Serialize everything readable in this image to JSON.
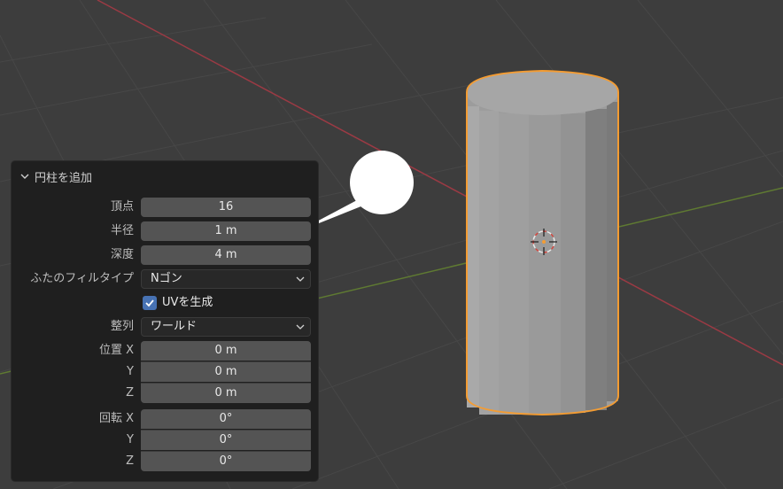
{
  "panel": {
    "title": "円柱を追加",
    "rows": {
      "vertices": {
        "label": "頂点",
        "value": "16"
      },
      "radius": {
        "label": "半径",
        "value": "1 m"
      },
      "depth": {
        "label": "深度",
        "value": "4 m"
      },
      "cap_fill": {
        "label": "ふたのフィルタイプ",
        "value": "Nゴン"
      },
      "generate_uv": {
        "label": "UVを生成",
        "checked": true
      },
      "align": {
        "label": "整列",
        "value": "ワールド"
      },
      "location": {
        "label": "位置 X",
        "x": "0 m",
        "y_label": "Y",
        "y": "0 m",
        "z_label": "Z",
        "z": "0 m"
      },
      "rotation": {
        "label": "回転 X",
        "x": "0°",
        "y_label": "Y",
        "y": "0°",
        "z_label": "Z",
        "z": "0°"
      }
    }
  },
  "icons": {
    "header": "chevron-down-icon",
    "dropdown": "chevron-down-icon",
    "checkbox": "checkmark-icon",
    "cursor": "3d-cursor-icon"
  },
  "colors": {
    "background": "#3d3d3d",
    "grid": "#474747",
    "x_axis": "#9b3a44",
    "y_axis": "#5f7a32",
    "selection_outline": "#f39c33",
    "checkbox": "#4772b3"
  }
}
